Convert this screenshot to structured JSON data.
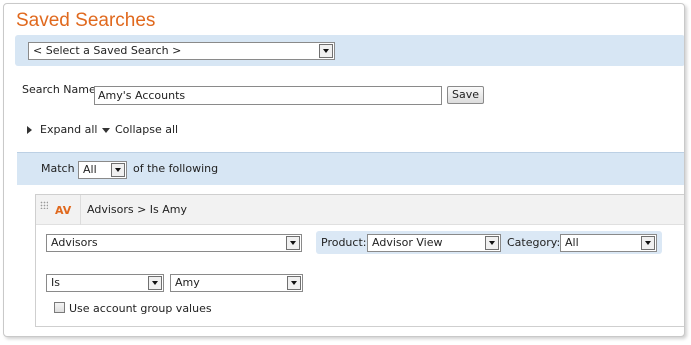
{
  "page_title": "Saved Searches",
  "saved_search_select": {
    "selected": "< Select a Saved Search >"
  },
  "search_name": {
    "label": "Search Name",
    "value": "Amy's Accounts",
    "save_label": "Save"
  },
  "expand": {
    "expand_label": "Expand all",
    "collapse_label": "Collapse all"
  },
  "match": {
    "prefix": "Match",
    "selected": "All",
    "suffix": "of the following"
  },
  "rule": {
    "badge": "AV",
    "summary": "Advisors > Is Amy",
    "field_select": "Advisors",
    "product_label": "Product:",
    "product_select": "Advisor View",
    "category_label": "Category:",
    "category_select": "All",
    "operator_select": "Is",
    "value_select": "Amy",
    "checkbox_label": "Use account group values"
  },
  "colors": {
    "title": "#e0691e",
    "band": "#d7e6f4"
  }
}
